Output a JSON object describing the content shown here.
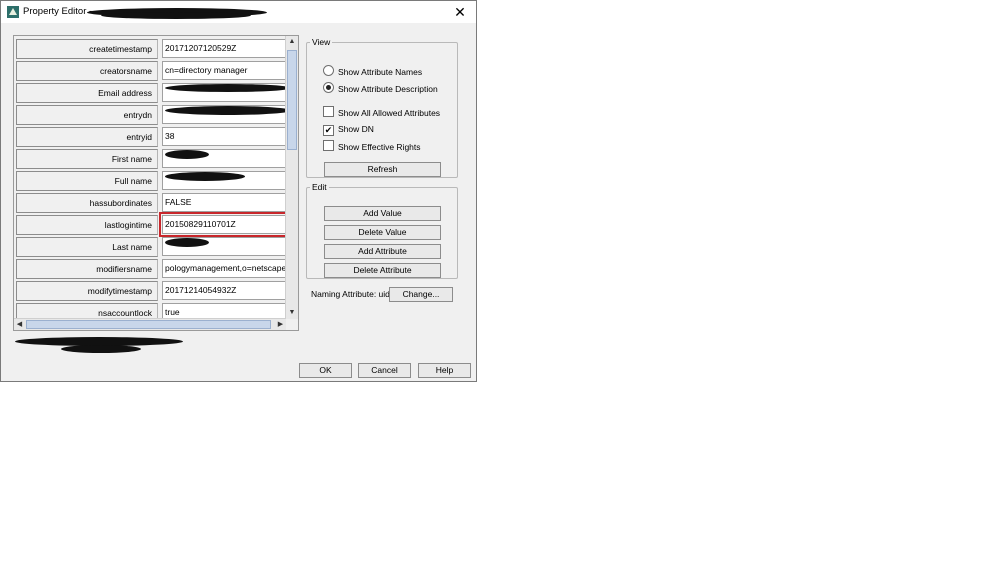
{
  "window": {
    "title": "Property Editor -",
    "title_redacted": "obscured text",
    "close_glyph": "✕"
  },
  "attributes": [
    {
      "name": "createtimestamp",
      "value": "20171207120529Z"
    },
    {
      "name": "creatorsname",
      "value": "cn=directory manager"
    },
    {
      "name": "Email address",
      "value": ""
    },
    {
      "name": "entrydn",
      "value": ""
    },
    {
      "name": "entryid",
      "value": "38"
    },
    {
      "name": "First name",
      "value": ""
    },
    {
      "name": "Full name",
      "value": ""
    },
    {
      "name": "hassubordinates",
      "value": "FALSE"
    },
    {
      "name": "lastlogintime",
      "value": "20150829110701Z"
    },
    {
      "name": "Last name",
      "value": ""
    },
    {
      "name": "modifiersname",
      "value": "pologymanagement,o=netscaperoo"
    },
    {
      "name": "modifytimestamp",
      "value": "20171214054932Z"
    },
    {
      "name": "nsaccountlock",
      "value": "true"
    }
  ],
  "view": {
    "legend": "View",
    "radio_names": "Show Attribute Names",
    "radio_description": "Show Attribute Description",
    "check_all_allowed": "Show All Allowed Attributes",
    "check_dn": "Show DN",
    "check_effective_rights": "Show Effective Rights",
    "refresh": "Refresh",
    "check_mark": "✔"
  },
  "edit": {
    "legend": "Edit",
    "add_value": "Add Value",
    "delete_value": "Delete Value",
    "add_attribute": "Add Attribute",
    "delete_attribute": "Delete Attribute"
  },
  "naming": {
    "label": "Naming Attribute: uid",
    "change": "Change..."
  },
  "footer": {
    "ok": "OK",
    "cancel": "Cancel",
    "help": "Help"
  },
  "icons": {
    "scroll_up": "▲",
    "scroll_down": "▼",
    "scroll_left": "◀",
    "scroll_right": "▶"
  },
  "colors": {
    "highlight": "#c8262b",
    "dialog_bg": "#f0f0f0"
  }
}
